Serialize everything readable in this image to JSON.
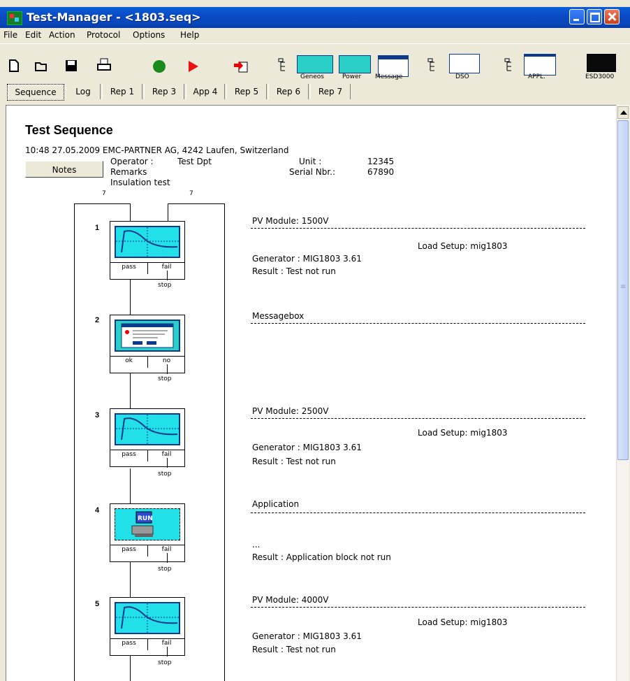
{
  "window": {
    "title": "Test-Manager - <1803.seq>"
  },
  "menu": [
    "File",
    "Edit",
    "Action",
    "Protocol",
    "Options",
    "Help"
  ],
  "toolbar": {
    "labels": [
      "Geneos",
      "Power",
      "Message",
      "DSO",
      "APPL.",
      "ESD3000"
    ]
  },
  "tabs": [
    "Sequence",
    "Log",
    "Rep 1",
    "Rep 3",
    "App 4",
    "Rep 5",
    "Rep 6",
    "Rep 7"
  ],
  "doc": {
    "heading": "Test Sequence",
    "info_line": "10:48 27.05.2009  EMC-PARTNER AG,  4242 Laufen,  Switzerland",
    "notes_button": "Notes",
    "operator_label": "Operator :",
    "operator_value": "Test Dpt",
    "remarks_label": "Remarks",
    "remarks_value": "Insulation test",
    "unit_label": "Unit :",
    "unit_value": "12345",
    "serial_label": "Serial Nbr.:",
    "serial_value": "67890",
    "loop_count_left": "7",
    "loop_count_right": "7"
  },
  "steps": [
    {
      "num": "1",
      "left": "pass",
      "right": "fail",
      "stop": "stop",
      "title": "PV Module: 1500V",
      "setup": "Load Setup: mig1803",
      "generator": "Generator : MIG1803    3.61",
      "result": "Result : Test not run"
    },
    {
      "num": "2",
      "left": "ok",
      "right": "no",
      "stop": "stop",
      "title": "Messagebox"
    },
    {
      "num": "3",
      "left": "pass",
      "right": "fail",
      "stop": "stop",
      "title": "PV Module: 2500V",
      "setup": "Load Setup: mig1803",
      "generator": "Generator : MIG1803    3.61",
      "result": "Result : Test not run"
    },
    {
      "num": "4",
      "left": "pass",
      "right": "fail",
      "stop": "stop",
      "title": "Application",
      "ellipsis": "...",
      "result": "Result : Application block not run",
      "run_label": "RUN"
    },
    {
      "num": "5",
      "left": "pass",
      "right": "fail",
      "stop": "stop",
      "title": "PV Module: 4000V",
      "setup": "Load Setup: mig1803",
      "generator": "Generator : MIG1803    3.61",
      "result": "Result : Test not run"
    }
  ]
}
